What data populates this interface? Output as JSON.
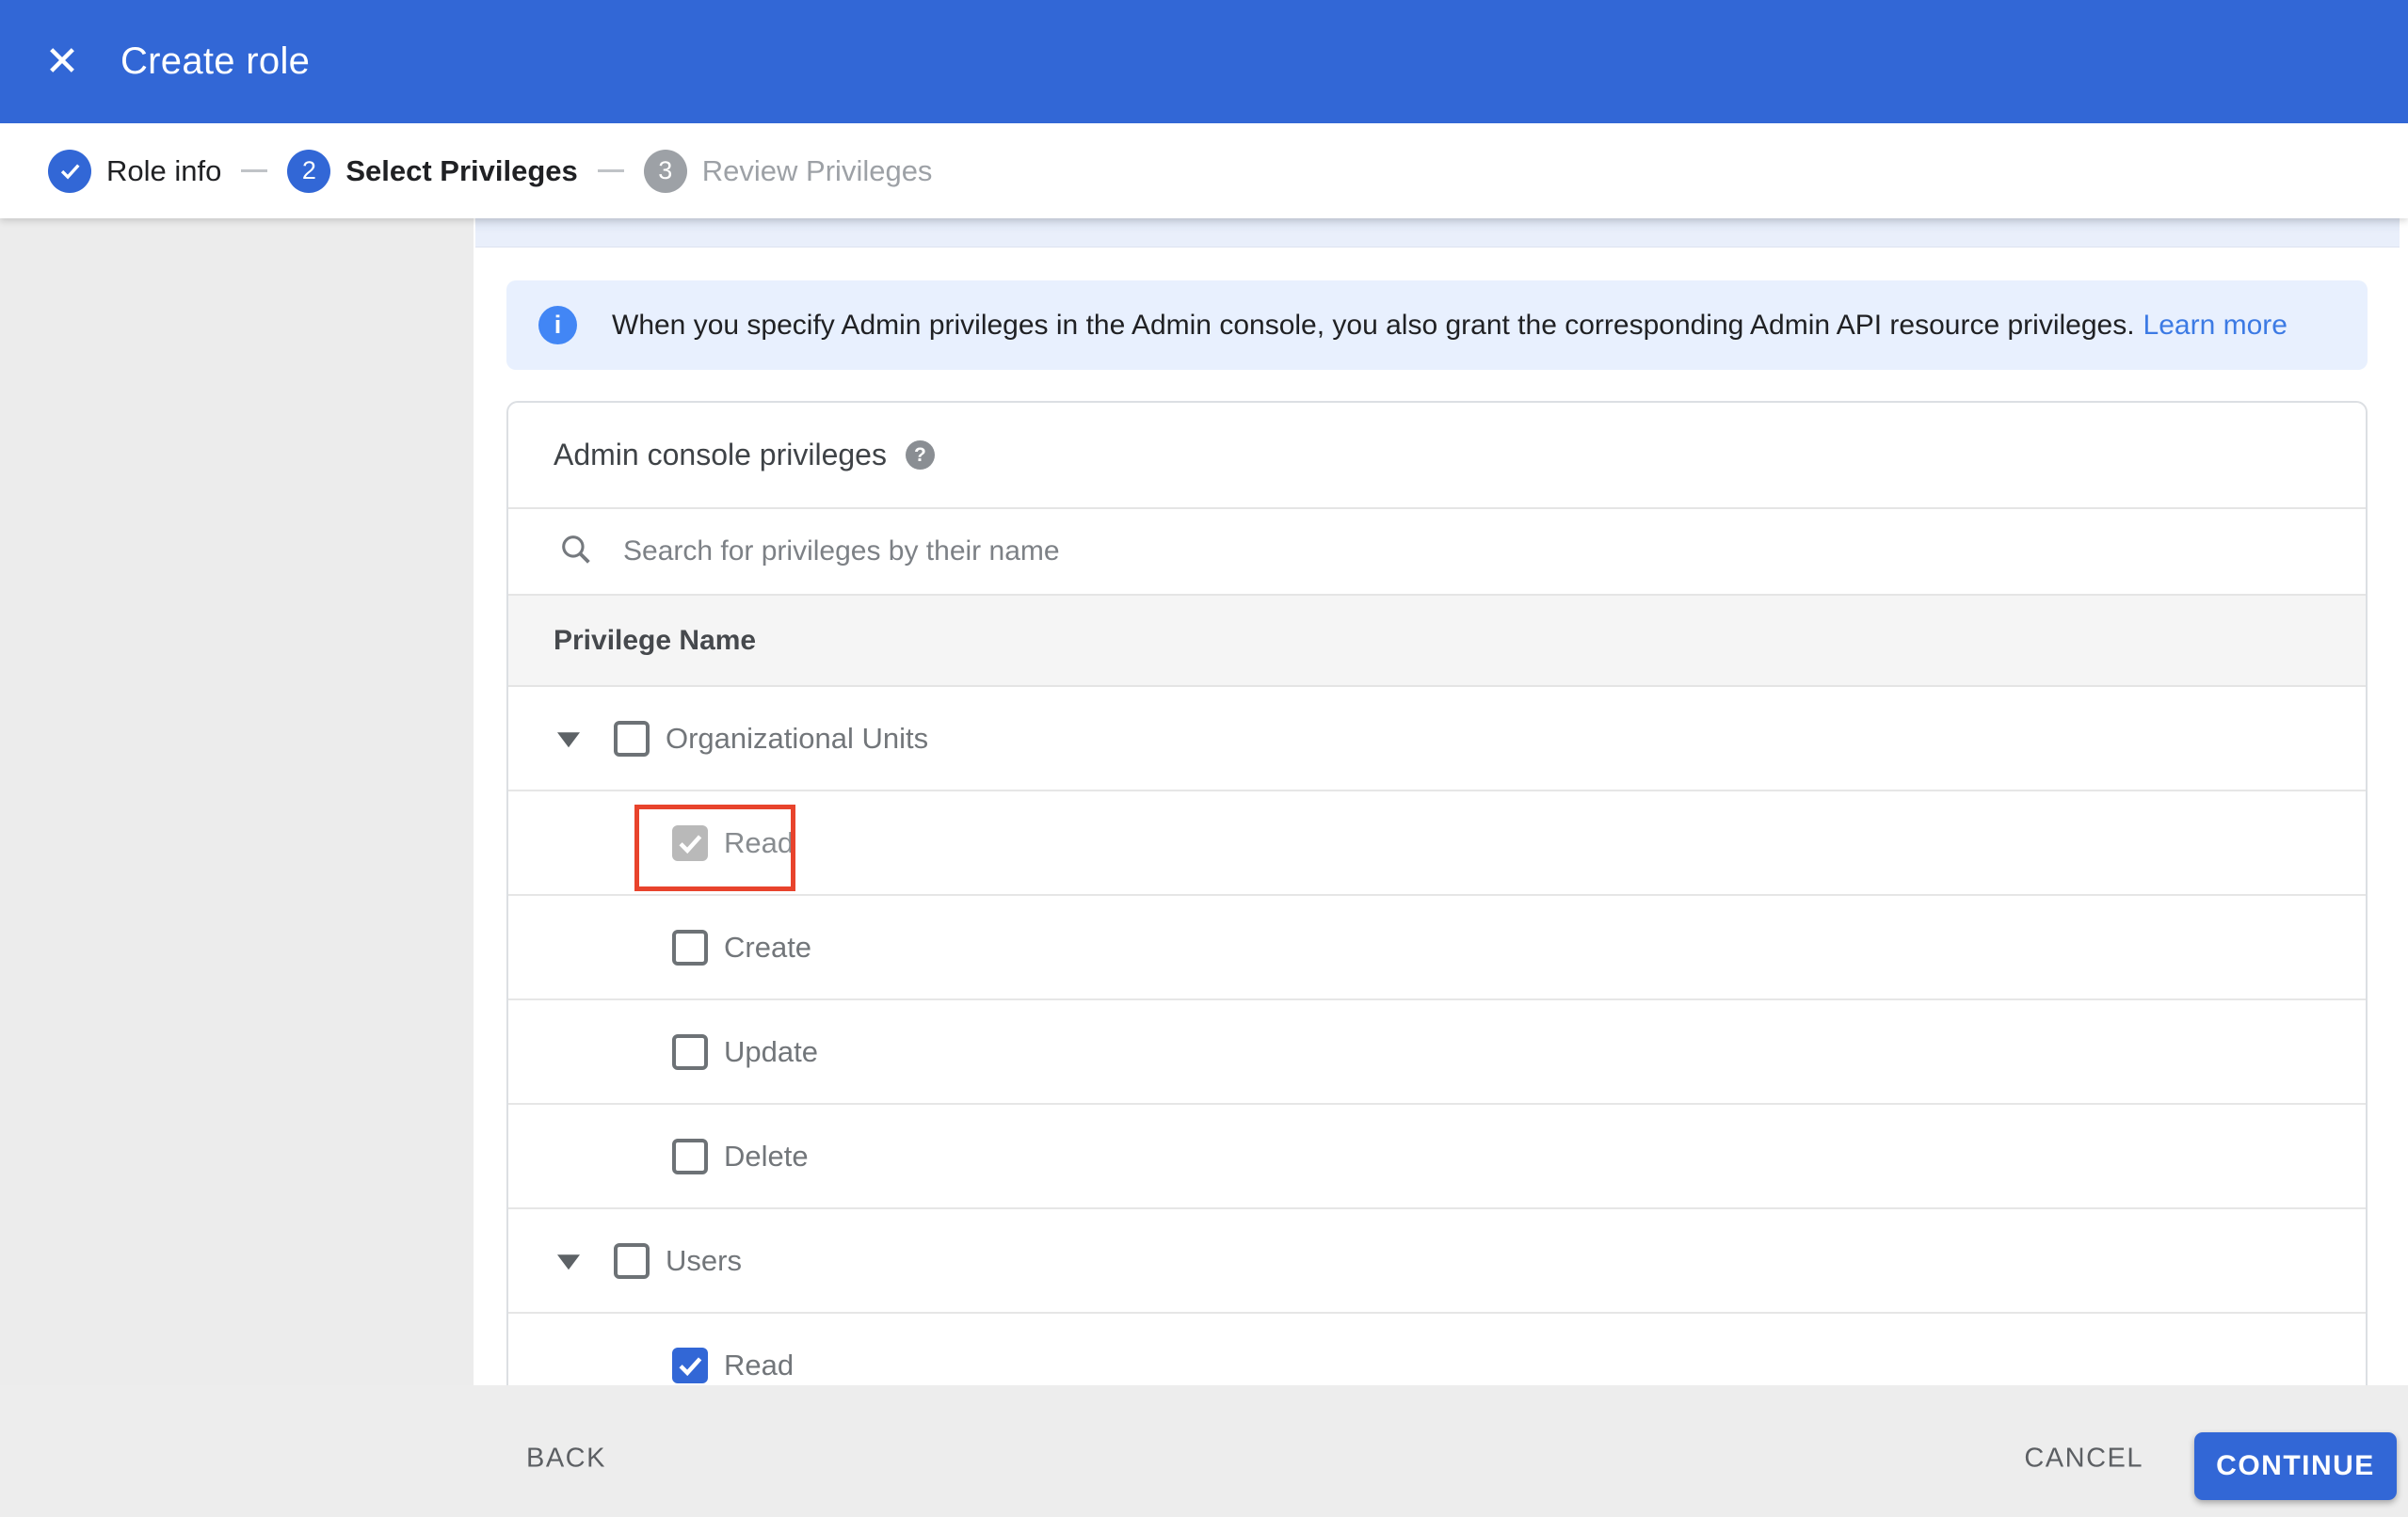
{
  "header": {
    "title": "Create role"
  },
  "stepper": {
    "steps": [
      {
        "number": "1",
        "label": "Role info",
        "state": "completed"
      },
      {
        "number": "2",
        "label": "Select Privileges",
        "state": "active"
      },
      {
        "number": "3",
        "label": "Review Privileges",
        "state": "upcoming"
      }
    ]
  },
  "info_banner": {
    "text": "When you specify Admin privileges in the Admin console, you also grant the corresponding Admin API resource privileges.",
    "link_label": "Learn more"
  },
  "privileges_card": {
    "title": "Admin console privileges",
    "search_placeholder": "Search for privileges by their name",
    "column_header": "Privilege Name",
    "rows": [
      {
        "label": "Organizational Units",
        "level": "group",
        "checked": false,
        "expanded": true
      },
      {
        "label": "Read",
        "level": "child",
        "checked": true,
        "disabled": true,
        "highlighted": true
      },
      {
        "label": "Create",
        "level": "child",
        "checked": false
      },
      {
        "label": "Update",
        "level": "child",
        "checked": false
      },
      {
        "label": "Delete",
        "level": "child",
        "checked": false
      },
      {
        "label": "Users",
        "level": "group",
        "checked": false,
        "expanded": true
      },
      {
        "label": "Read",
        "level": "child",
        "checked": true,
        "clipped": true
      }
    ]
  },
  "footer": {
    "back_label": "BACK",
    "cancel_label": "CANCEL",
    "continue_label": "CONTINUE"
  },
  "colors": {
    "primary_blue": "#3267d6",
    "info_icon_blue": "#4286f5",
    "link_blue": "#3c7ae4",
    "banner_bg": "#e8f0fe",
    "highlight_red": "#e8432c"
  }
}
